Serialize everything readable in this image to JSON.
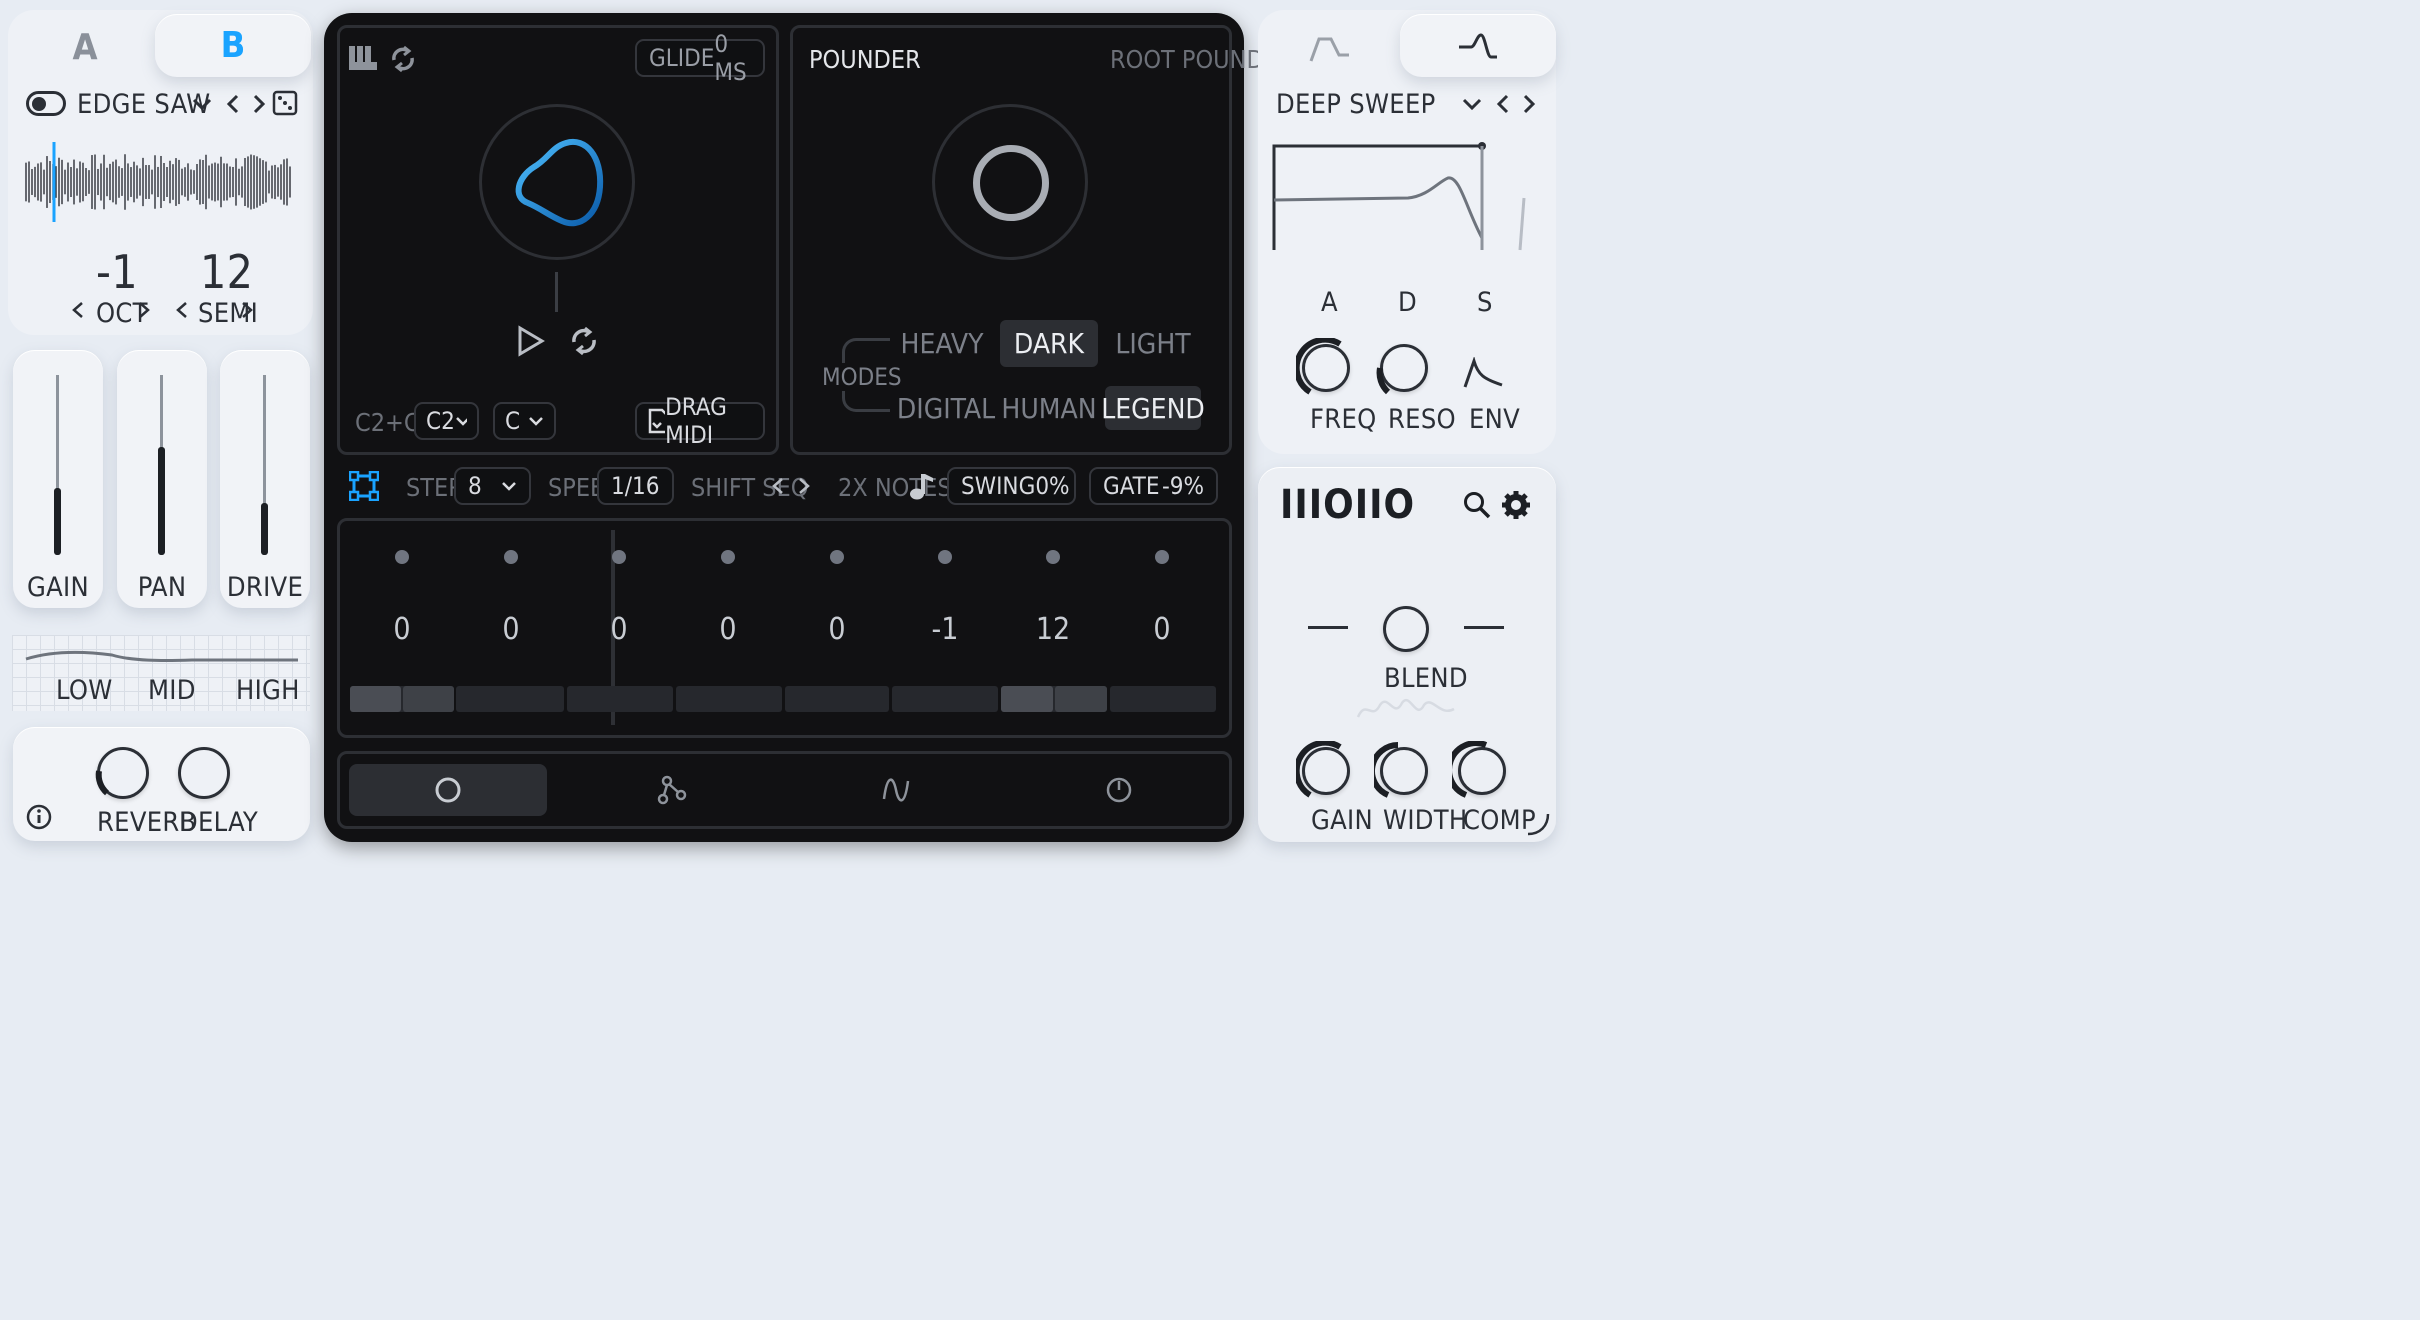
{
  "left": {
    "osc_tabs": [
      "A",
      "B"
    ],
    "osc_active": "B",
    "preset_name": "EDGE SAW",
    "oct": {
      "value": "-1",
      "label": "OCT"
    },
    "semi": {
      "value": "12",
      "label": "SEMI"
    },
    "sliders": [
      {
        "label": "GAIN",
        "level": 0.37
      },
      {
        "label": "PAN",
        "level": 0.6
      },
      {
        "label": "DRIVE",
        "level": 0.29
      }
    ],
    "eq_labels": [
      "LOW",
      "MID",
      "HIGH"
    ],
    "fx_knobs": [
      "REVERB",
      "DELAY"
    ]
  },
  "center": {
    "glide_label": "GLIDE",
    "glide_value": "0 MS",
    "range_label": "C2+C",
    "root_select": "C2",
    "key_select": "C",
    "drag_midi": "DRAG MIDI",
    "pounder_title": "POUNDER",
    "pounder_preset": "ROOT POUNDER",
    "modes_label": "MODES",
    "modes": [
      "HEAVY",
      "DARK",
      "LIGHT",
      "DIGITAL",
      "HUMAN",
      "LEGEND"
    ],
    "modes_active": [
      "DARK",
      "LEGEND"
    ],
    "seq": {
      "steps_label": "STEPS",
      "steps_value": "8",
      "speed_label": "SPEED",
      "speed_value": "1/16",
      "shift_label": "SHIFT SEQ",
      "notes_label": "2X NOTES",
      "swing_label": "SWING",
      "swing_value": "0%",
      "gate_label": "GATE",
      "gate_value": "-9%",
      "values": [
        "0",
        "0",
        "0",
        "0",
        "0",
        "-1",
        "12",
        "0"
      ]
    },
    "bottom_tabs": [
      "circle-icon",
      "nodes-icon",
      "wave-icon",
      "power-icon"
    ]
  },
  "right": {
    "filter_preset": "DEEP SWEEP",
    "adsr_labels": [
      "A",
      "D",
      "S"
    ],
    "filter_knobs": [
      "FREQ",
      "RESO",
      "ENV"
    ],
    "logo": "IIIOIIO",
    "blend_label": "BLEND",
    "master_knobs": [
      "GAIN",
      "WIDTH",
      "COMP"
    ]
  },
  "colors": {
    "accent": "#1aa3ff",
    "dark_bg": "#111113",
    "light_bg": "#eef1f6"
  }
}
